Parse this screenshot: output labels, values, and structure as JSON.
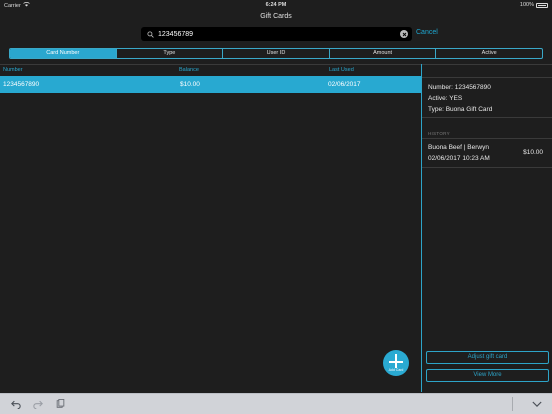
{
  "status_bar": {
    "carrier": "Carrier",
    "time": "6:24 PM",
    "battery": "100%"
  },
  "nav": {
    "title": "Gift Cards"
  },
  "search": {
    "value": "123456789",
    "cancel_label": "Cancel"
  },
  "segments": [
    {
      "label": "Card Number",
      "active": true
    },
    {
      "label": "Type",
      "active": false
    },
    {
      "label": "User ID",
      "active": false
    },
    {
      "label": "Amount",
      "active": false
    },
    {
      "label": "Active",
      "active": false
    }
  ],
  "table": {
    "headers": {
      "number": "Number",
      "balance": "Balance",
      "last_used": "Last Used"
    },
    "rows": [
      {
        "number": "1234567890",
        "balance": "$10.00",
        "last_used": "02/06/2017"
      }
    ]
  },
  "detail": {
    "number_line": "Number: 1234567890",
    "active_line": "Active: YES",
    "type_line": "Type: Buona Gift Card",
    "history_label": "HISTORY",
    "history": [
      {
        "location": "Buona Beef | Berwyn",
        "date": "02/06/2017 10:23 AM",
        "amount": "$10.00"
      }
    ],
    "adjust_label": "Adjust gift card",
    "view_more_label": "View More"
  },
  "fab": {
    "label": "Add Card"
  },
  "colors": {
    "accent": "#2aa7cf",
    "background": "#1e1e1e",
    "toolbar": "#d1d3d8"
  }
}
